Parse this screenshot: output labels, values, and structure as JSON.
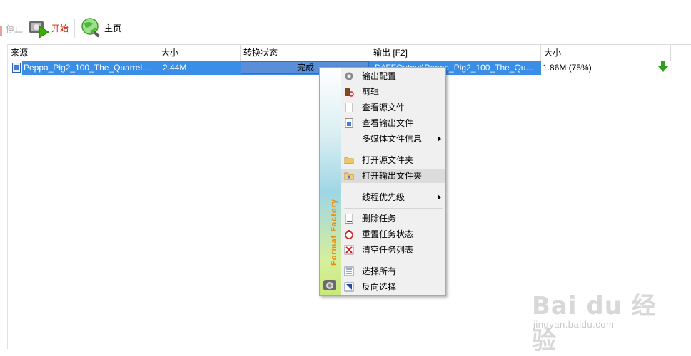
{
  "toolbar": {
    "stop_label": "停止",
    "start_label": "开始",
    "home_label": "主页"
  },
  "table": {
    "columns": [
      "来源",
      "大小",
      "转换状态",
      "输出 [F2]",
      "大小"
    ],
    "rows": [
      {
        "source": "Peppa_Pig2_100_The_Quarrel....",
        "size": "2.44M",
        "status": "完成",
        "output": "D:\\FFOutput\\Peppa_Pig2_100_The_Qu...",
        "out_size": "1.86M  (75%)"
      }
    ]
  },
  "context_menu": {
    "brand": "Format Factory",
    "items": [
      {
        "label": "输出配置",
        "icon": "gear-icon"
      },
      {
        "label": "剪辑",
        "icon": "clip-icon"
      },
      {
        "label": "查看源文件",
        "icon": "document-icon"
      },
      {
        "label": "查看输出文件",
        "icon": "output-file-icon"
      },
      {
        "label": "多媒体文件信息",
        "icon": "",
        "submenu": true
      },
      {
        "label": "打开源文件夹",
        "icon": "folder-icon"
      },
      {
        "label": "打开输出文件夹",
        "icon": "folder-open-icon"
      },
      {
        "label": "线程优先级",
        "icon": "",
        "submenu": true
      },
      {
        "label": "删除任务",
        "icon": "delete-task-icon"
      },
      {
        "label": "重置任务状态",
        "icon": "reset-icon"
      },
      {
        "label": "清空任务列表",
        "icon": "clear-list-icon"
      },
      {
        "label": "选择所有",
        "icon": "select-all-icon"
      },
      {
        "label": "反向选择",
        "icon": "invert-selection-icon"
      }
    ]
  },
  "watermark": {
    "text": "Bai du 经验",
    "sub": "jingyan.baidu.com"
  },
  "colors": {
    "selection": "#3a8ee6",
    "start_text": "#d62000",
    "brand": "#f08a00"
  }
}
